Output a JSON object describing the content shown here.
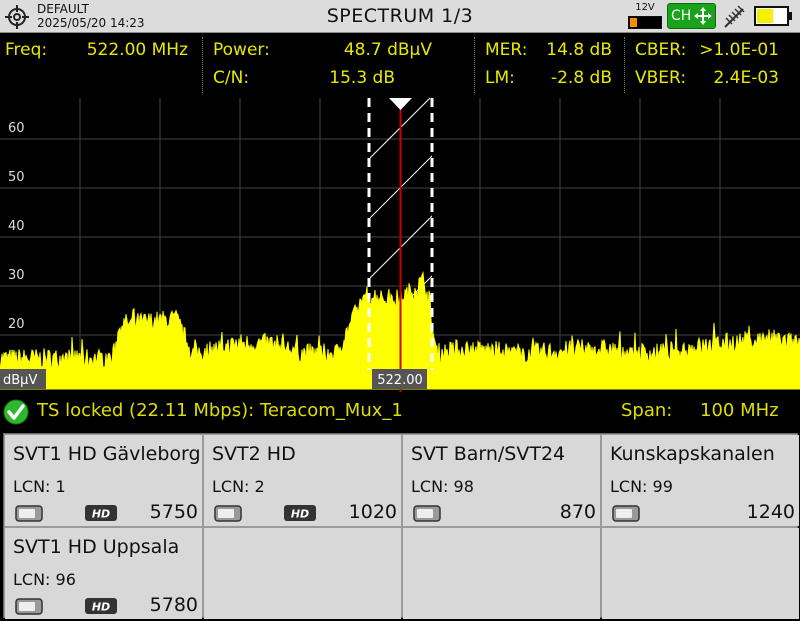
{
  "topbar": {
    "profile": "DEFAULT",
    "datetime": "2025/05/20 14:23",
    "title": "SPECTRUM 1/3",
    "voltage": "12V",
    "ch_label": "CH"
  },
  "measurements": {
    "freq_label": "Freq:",
    "freq_value": "522.00 MHz",
    "power_label": "Power:",
    "power_value": "48.7 dBµV",
    "cn_label": "C/N:",
    "cn_value": "15.3 dB",
    "mer_label": "MER:",
    "mer_value": "14.8 dB",
    "lm_label": "LM:",
    "lm_value": "-2.8 dB",
    "cber_label": "CBER:",
    "cber_value": ">1.0E-01",
    "vber_label": "VBER:",
    "vber_value": "2.4E-03"
  },
  "spectrum": {
    "y_ticks": [
      "60",
      "50",
      "40",
      "30",
      "20"
    ],
    "unit": "dBµV",
    "marker_label": "522.00",
    "colors": {
      "trace": "#ffff00",
      "marker": "#cc0000",
      "grid": "#444444",
      "window": "#ffffff"
    }
  },
  "chart_data": {
    "type": "area",
    "unit": "dBµV",
    "ylim": [
      12,
      72
    ],
    "x_center_mhz": 522.0,
    "span_mhz": 100,
    "x_mhz": [
      472,
      477,
      480,
      486,
      487,
      494,
      496,
      502,
      506,
      510,
      514,
      517.5,
      522,
      525,
      526.5,
      530,
      538,
      546,
      554,
      562,
      568,
      572
    ],
    "y": [
      15,
      15,
      15,
      15,
      22,
      23,
      16,
      18,
      18,
      16,
      16,
      28,
      27,
      31,
      16,
      17,
      16,
      17,
      16,
      18,
      19,
      18
    ]
  },
  "status": {
    "lock_text": "TS locked (22.11 Mbps): Teracom_Mux_1",
    "span_label": "Span:",
    "span_value": "100 MHz"
  },
  "services": [
    {
      "name": "SVT1 HD Gävleborg",
      "lcn": "LCN: 1",
      "value": "5750",
      "hd": true
    },
    {
      "name": "SVT2 HD",
      "lcn": "LCN: 2",
      "value": "1020",
      "hd": true
    },
    {
      "name": "SVT Barn/SVT24",
      "lcn": "LCN: 98",
      "value": "870",
      "hd": false
    },
    {
      "name": "Kunskapskanalen",
      "lcn": "LCN: 99",
      "value": "1240",
      "hd": false
    },
    {
      "name": "SVT1 HD Uppsala",
      "lcn": "LCN: 96",
      "value": "5780",
      "hd": true
    }
  ]
}
